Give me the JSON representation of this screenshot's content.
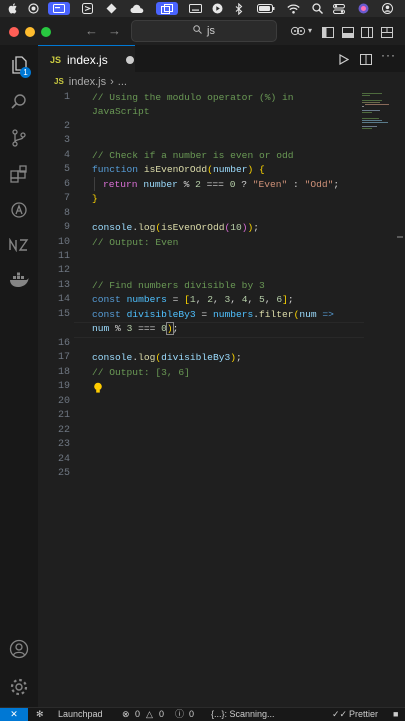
{
  "titlebar": {
    "search_text": "js"
  },
  "tab": {
    "filename": "index.js",
    "icon_label": "JS"
  },
  "breadcrumb": {
    "filename": "index.js",
    "icon_label": "JS",
    "more": "..."
  },
  "activity": {
    "explorer_badge": "1"
  },
  "line_numbers": [
    "1",
    "",
    "2",
    "3",
    "4",
    "5",
    "6",
    "7",
    "8",
    "9",
    "10",
    "11",
    "12",
    "13",
    "14",
    "15",
    "",
    "16",
    "17",
    "18",
    "19",
    "20",
    "21",
    "22",
    "23",
    "24",
    "25"
  ],
  "code": {
    "l1a": "// Using the modulo operator (%) in",
    "l1b": "JavaScript",
    "l4": "// Check if a number is even or odd",
    "l5_kw": "function",
    "l5_fn": "isEvenOrOdd",
    "l5_param": "number",
    "l6_kw": "return",
    "l6_var": "number",
    "l6_op": " % ",
    "l6_n2": "2",
    "l6_eq": " === ",
    "l6_n0": "0",
    "l6_q": " ? ",
    "l6_even": "\"Even\"",
    "l6_colon": " : ",
    "l6_odd": "\"Odd\"",
    "l9_obj": "console",
    "l9_fn": "log",
    "l9_inner": "isEvenOrOdd",
    "l9_arg": "10",
    "l10": "// Output: Even",
    "l13": "// Find numbers divisible by 3",
    "l14_kw": "const",
    "l14_var": "numbers",
    "l14_vals": [
      "1",
      "2",
      "3",
      "4",
      "5",
      "6"
    ],
    "l15_kw": "const",
    "l15_var": "divisibleBy3",
    "l15_obj": "numbers",
    "l15_fn": "filter",
    "l15_param": "num",
    "l15_arrow": "=>",
    "l15b_var": "num",
    "l15b_op": " % ",
    "l15b_n3": "3",
    "l15b_eq": " === ",
    "l15b_n0": "0",
    "l17_obj": "console",
    "l17_fn": "log",
    "l17_arg": "divisibleBy3",
    "l18": "// Output: [3, 6]"
  },
  "statusbar": {
    "launchpad": "Launchpad",
    "errors": "0",
    "warnings": "0",
    "info": "0",
    "scanning": "{...}: Scanning...",
    "prettier": "Prettier"
  },
  "colors": {
    "accent": "#0078d4",
    "js_icon": "#cbcb41",
    "close_red": "#ff5f57",
    "min_yellow": "#febc2e",
    "max_green": "#28c840"
  }
}
